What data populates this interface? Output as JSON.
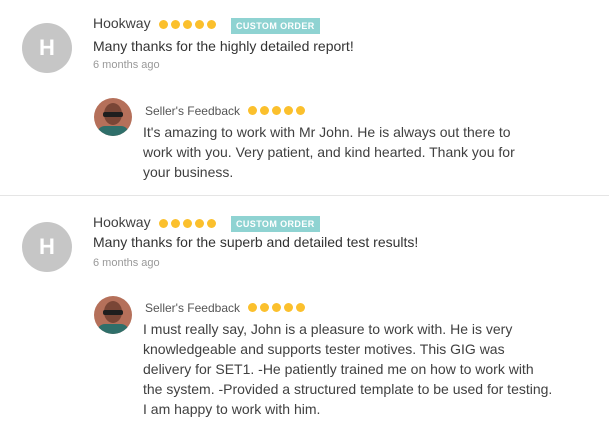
{
  "reviews": [
    {
      "reviewer_initial": "H",
      "reviewer_name": "Hookway",
      "rating": 5,
      "badge": "CUSTOM ORDER",
      "message": "Many thanks for the highly detailed report!",
      "time": "6 months ago",
      "seller_label": "Seller's Feedback",
      "seller_rating": 5,
      "seller_text": "It's amazing to work with Mr John. He is always out there to work with you. Very patient, and kind hearted. Thank you for your business."
    },
    {
      "reviewer_initial": "H",
      "reviewer_name": "Hookway",
      "rating": 5,
      "badge": "CUSTOM ORDER",
      "message": "Many thanks for the superb and detailed test results!",
      "time": "6 months ago",
      "seller_label": "Seller's Feedback",
      "seller_rating": 5,
      "seller_text": "I must really say, John is a pleasure to work with. He is very knowledgeable and supports tester motives. This GIG was delivery for SET1. -He patiently trained me on how to work with the system. -Provided a structured template to be used for testing. I am happy to work with him."
    }
  ],
  "colors": {
    "star": "#fbc02d",
    "badge_bg": "#8fd3d2",
    "avatar_bg": "#c6c6c6"
  }
}
